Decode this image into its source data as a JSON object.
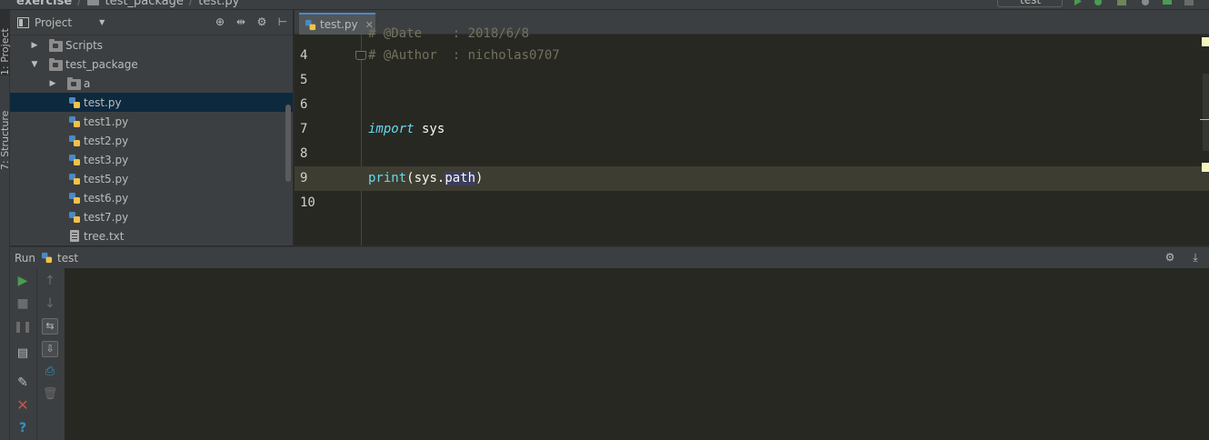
{
  "breadcrumb": {
    "project": "exercise",
    "package": "test_package",
    "file": "test.py"
  },
  "toolbar": {
    "run_config": "test"
  },
  "side_tabs": {
    "project": "1: Project",
    "structure": "7: Structure"
  },
  "project_panel": {
    "title": "Project",
    "tree": [
      {
        "label": "Scripts",
        "type": "folder",
        "expanded": false,
        "depth": 1
      },
      {
        "label": "test_package",
        "type": "folder",
        "expanded": true,
        "depth": 1
      },
      {
        "label": "a",
        "type": "folder",
        "expanded": false,
        "depth": 2
      },
      {
        "label": "test.py",
        "type": "python",
        "selected": true,
        "depth": 2
      },
      {
        "label": "test1.py",
        "type": "python",
        "depth": 2
      },
      {
        "label": "test2.py",
        "type": "python",
        "depth": 2
      },
      {
        "label": "test3.py",
        "type": "python",
        "depth": 2
      },
      {
        "label": "test5.py",
        "type": "python",
        "depth": 2
      },
      {
        "label": "test6.py",
        "type": "python",
        "depth": 2
      },
      {
        "label": "test7.py",
        "type": "python",
        "depth": 2
      },
      {
        "label": "tree.txt",
        "type": "text",
        "depth": 2
      }
    ]
  },
  "editor": {
    "active_tab": "test.py",
    "partial_top_line": "# @Date    : 2018/6/8",
    "lines": [
      {
        "num": "4",
        "text": "# @Author  : nicholas0707"
      },
      {
        "num": "5",
        "text": ""
      },
      {
        "num": "6",
        "text": ""
      },
      {
        "num": "7",
        "keyword": "import",
        "rest": " sys"
      },
      {
        "num": "8",
        "text": ""
      },
      {
        "num": "9",
        "builtin": "print",
        "paren_open": "(sys.",
        "highlight": "path",
        "paren_close": ")"
      },
      {
        "num": "10",
        "text": ""
      }
    ],
    "current_line": "9"
  },
  "run_panel": {
    "label": "Run",
    "config": "test"
  },
  "colors": {
    "editor_bg": "#272822",
    "panel_bg": "#3c3f41",
    "keyword": "#66d9ef",
    "comment": "#75715e",
    "run_green": "#499c54",
    "stop_red": "#c75450",
    "help_blue": "#3592c4"
  }
}
